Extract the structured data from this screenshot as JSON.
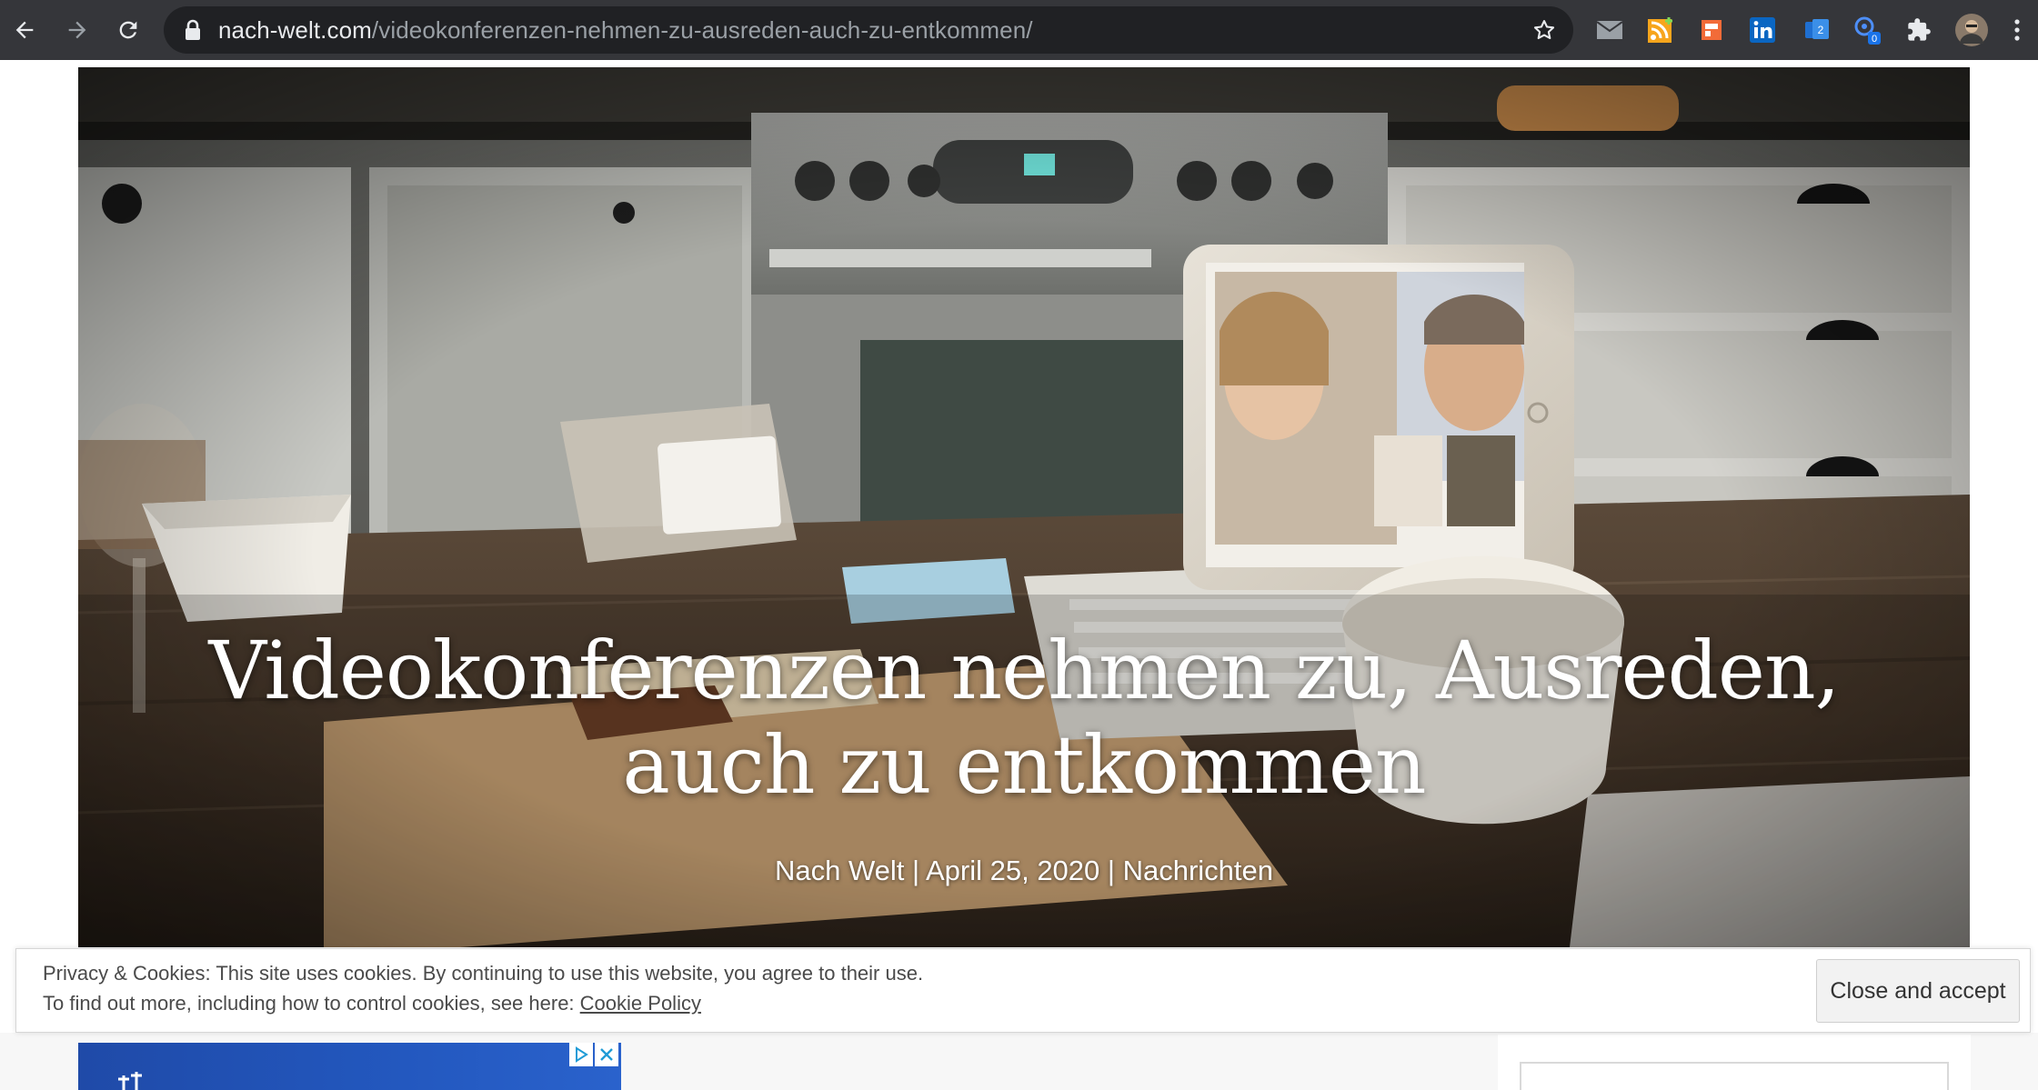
{
  "browser": {
    "url_host": "nach-welt.com",
    "url_path": "/videokonferenzen-nehmen-zu-ausreden-auch-zu-entkommen/",
    "icons": [
      "back-arrow-icon",
      "forward-arrow-icon",
      "reload-icon",
      "lock-icon",
      "star-icon",
      "mail-icon",
      "rss-icon",
      "bookmark-icon",
      "linkedin-icon",
      "extension-icon",
      "translate-icon",
      "puzzle-icon",
      "avatar",
      "menu-icon"
    ],
    "extension_badge": "0",
    "extension_badge2": "2"
  },
  "article": {
    "title": "Videokonferenzen nehmen zu, Ausreden, auch zu entkommen",
    "author": "Nach Welt",
    "date": "April 25, 2020",
    "category": "Nachrichten",
    "separator": " | "
  },
  "cookie_banner": {
    "line1": "Privacy & Cookies: This site uses cookies. By continuing to use this website, you agree to their use.",
    "line2_prefix": "To find out more, including how to control cookies, see here: ",
    "link": "Cookie Policy",
    "accept_label": "Close and accept"
  },
  "colors": {
    "toolbar_bg": "#35363a",
    "omnibox_bg": "#202124",
    "url_host": "#e8eaed",
    "url_path": "#9aa0a6",
    "ad_blue": "#2358bf",
    "linkedin": "#0a66c2",
    "rss": "#f7a51c"
  }
}
